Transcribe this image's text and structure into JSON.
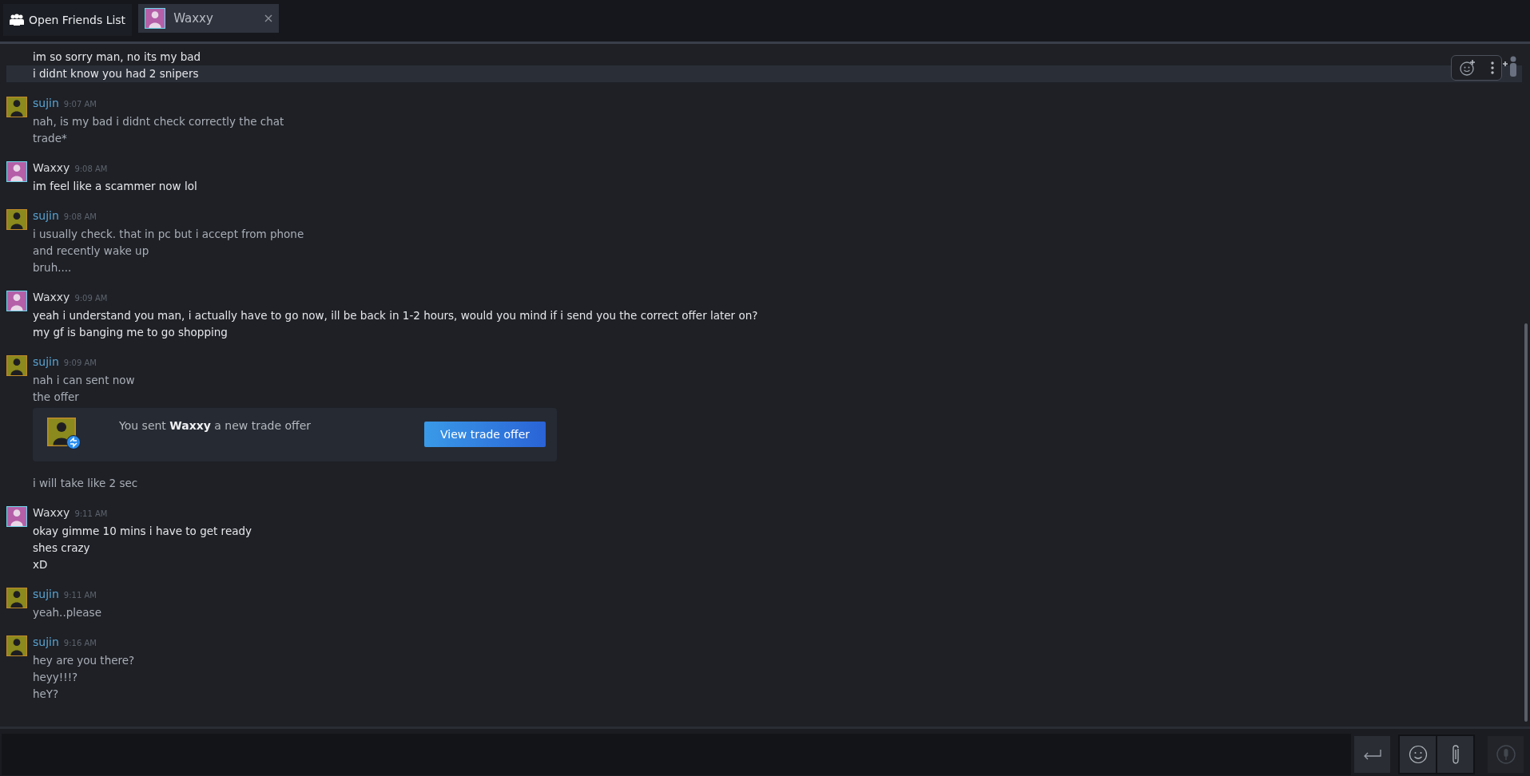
{
  "top_bar": {
    "friends_button": "Open Friends List",
    "tabs": [
      {
        "label": "Waxxy",
        "kind": "self",
        "selected": true
      }
    ]
  },
  "messages": [
    {
      "kind": "self",
      "items": [
        {
          "kind": "text",
          "text": "im so sorry man, no its my bad",
          "highlighted": false
        },
        {
          "kind": "text",
          "text": "i didnt know you had 2 snipers",
          "highlighted": true
        }
      ]
    },
    {
      "kind": "friend",
      "sender": "sujin",
      "time": "9:07 AM",
      "items": [
        {
          "kind": "text",
          "text": "nah, is my bad i didnt check correctly the chat",
          "highlighted": false
        },
        {
          "kind": "text",
          "text": "trade*",
          "highlighted": false
        }
      ]
    },
    {
      "kind": "self",
      "sender": "Waxxy",
      "time": "9:08 AM",
      "items": [
        {
          "kind": "text",
          "text": "im feel like a scammer now lol",
          "highlighted": false
        }
      ]
    },
    {
      "kind": "friend",
      "sender": "sujin",
      "time": "9:08 AM",
      "items": [
        {
          "kind": "text",
          "text": "i usually check. that in pc but i accept from phone",
          "highlighted": false
        },
        {
          "kind": "text",
          "text": "and recently wake up",
          "highlighted": false
        },
        {
          "kind": "text",
          "text": "bruh....",
          "highlighted": false
        }
      ]
    },
    {
      "kind": "self",
      "sender": "Waxxy",
      "time": "9:09 AM",
      "items": [
        {
          "kind": "text",
          "text": "yeah i understand you man, i actually have to go now, ill be back in 1-2 hours, would you mind if i send you the correct offer later on?",
          "highlighted": false
        },
        {
          "kind": "text",
          "text": "my gf is banging me to go shopping",
          "highlighted": false
        }
      ]
    },
    {
      "kind": "friend",
      "sender": "sujin",
      "time": "9:09 AM",
      "items": [
        {
          "kind": "text",
          "text": "nah i can sent now",
          "highlighted": false
        },
        {
          "kind": "text",
          "text": "the offer",
          "highlighted": false
        },
        {
          "kind": "trade",
          "text": "You sent **Waxxy** a new trade offer",
          "button": "View trade offer"
        },
        {
          "kind": "text",
          "text": "i will take like 2 sec",
          "highlighted": false
        }
      ]
    },
    {
      "kind": "self",
      "sender": "Waxxy",
      "time": "9:11 AM",
      "items": [
        {
          "kind": "text",
          "text": "okay gimme 10 mins i have to get ready",
          "highlighted": false
        },
        {
          "kind": "text",
          "text": "shes crazy",
          "highlighted": false
        },
        {
          "kind": "text",
          "text": "xD",
          "highlighted": false
        }
      ]
    },
    {
      "kind": "friend",
      "sender": "sujin",
      "time": "9:11 AM",
      "items": [
        {
          "kind": "text",
          "text": "yeah..please",
          "highlighted": false
        }
      ]
    },
    {
      "kind": "friend",
      "sender": "sujin",
      "time": "9:16 AM",
      "items": [
        {
          "kind": "text",
          "text": "hey are you there?",
          "highlighted": false
        },
        {
          "kind": "text",
          "text": "heyy!!!?",
          "highlighted": false
        },
        {
          "kind": "text",
          "text": "heY?",
          "highlighted": false
        }
      ]
    }
  ]
}
